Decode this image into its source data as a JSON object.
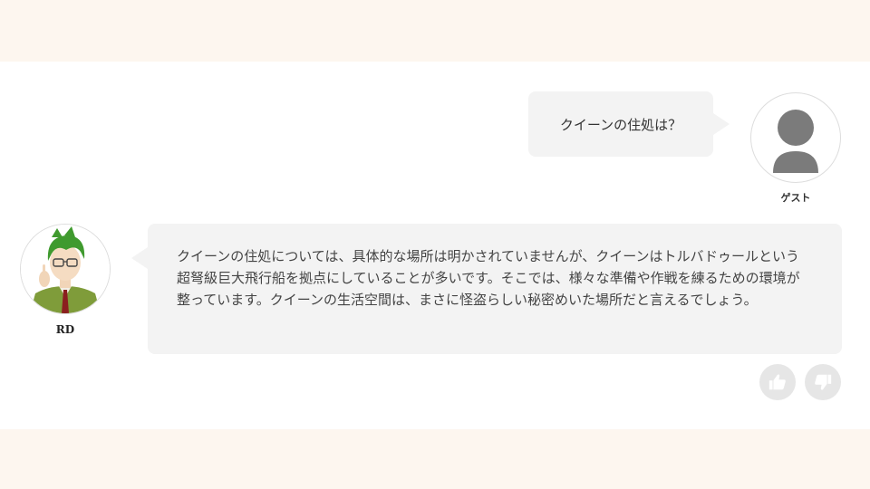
{
  "user": {
    "message": "クイーンの住処は？",
    "name": "ゲスト",
    "avatar_icon": "person-silhouette-icon"
  },
  "bot": {
    "name": "RD",
    "avatar_icon": "green-haired-character-avatar",
    "message": "クイーンの住処については、具体的な場所は明かされていませんが、クイーンはトルバドゥールという超弩級巨大飛行船を拠点にしていることが多いです。そこでは、様々な準備や作戦を練るための環境が整っています。クイーンの生活空間は、まさに怪盗らしい秘密めいた場所だと言えるでしょう。"
  },
  "feedback": {
    "like_icon": "thumbs-up-icon",
    "dislike_icon": "thumbs-down-icon"
  },
  "colors": {
    "band": "#fdf6ef",
    "bubble": "#f3f3f3",
    "button": "#e6e6e6"
  }
}
